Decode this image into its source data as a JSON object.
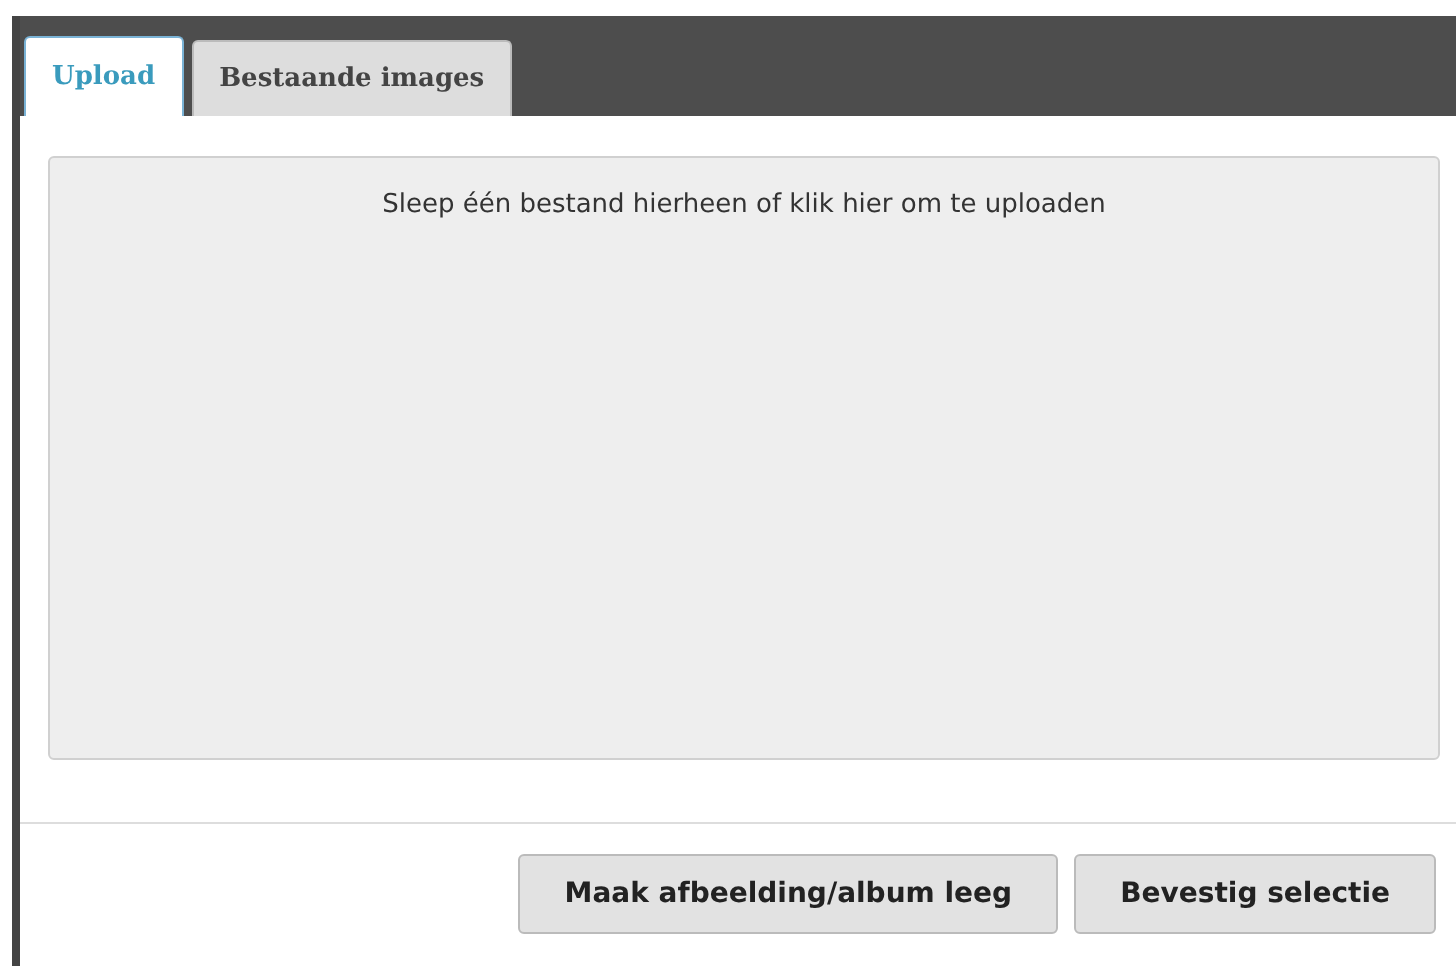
{
  "tabs": [
    {
      "label": "Upload",
      "selected": true
    },
    {
      "label": "Bestaande images",
      "selected": false
    }
  ],
  "dropzone": {
    "text": "Sleep één bestand hierheen of klik hier om te uploaden"
  },
  "buttons": [
    "Maak afbeelding/album leeg",
    "Bevestig selectie"
  ]
}
